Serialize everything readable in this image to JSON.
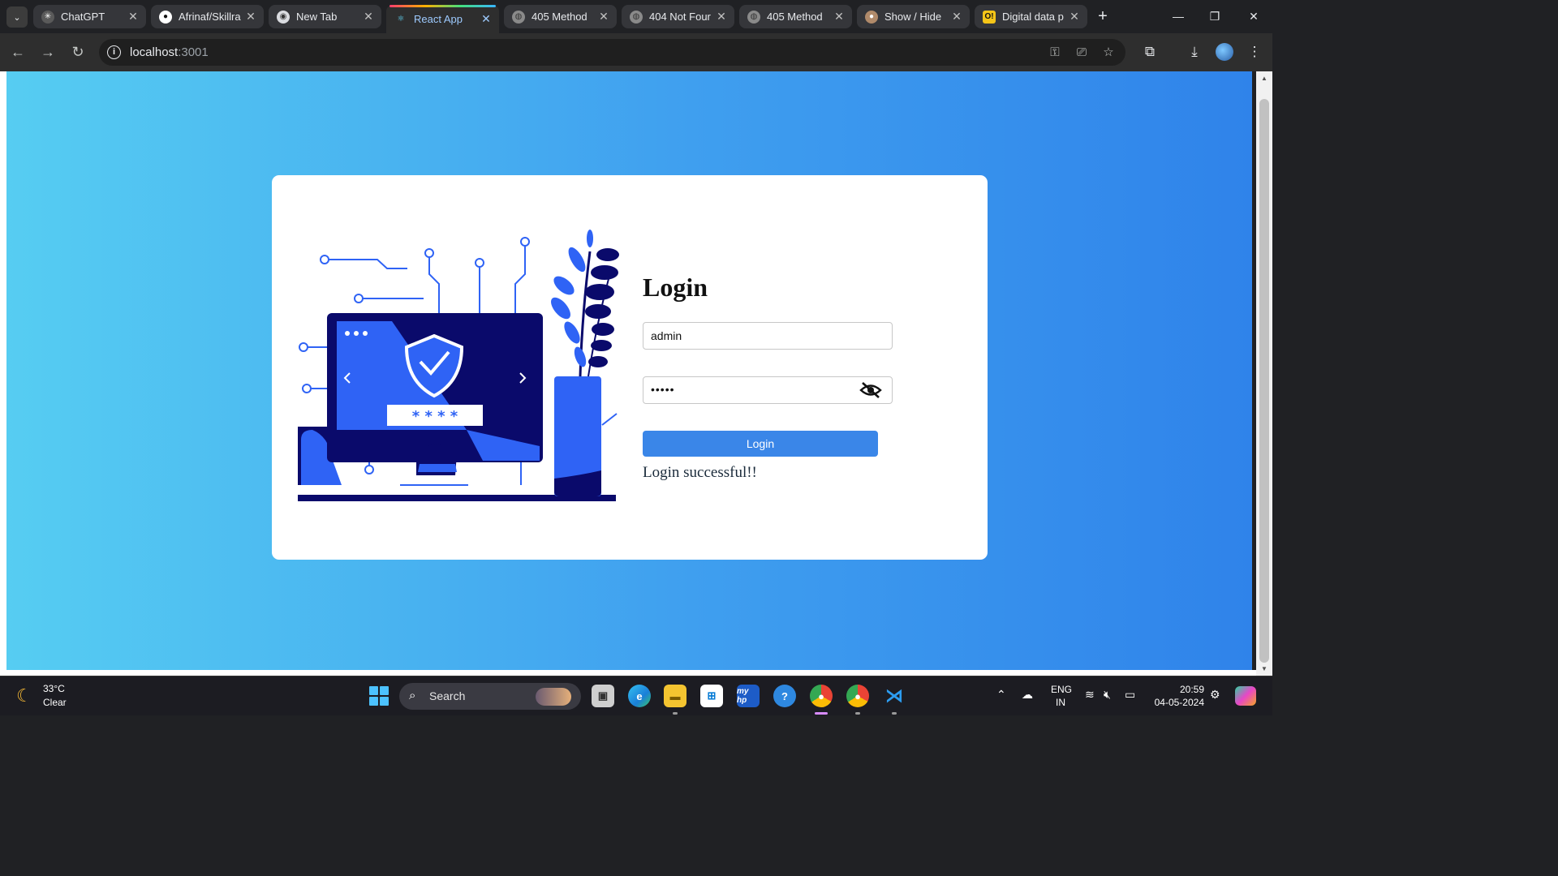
{
  "browser": {
    "tabs": [
      {
        "title": "ChatGPT",
        "icon": "chatgpt-icon"
      },
      {
        "title": "Afrinaf/Skillra",
        "icon": "github-icon"
      },
      {
        "title": "New Tab",
        "icon": "chrome-icon"
      },
      {
        "title": "React App",
        "icon": "react-icon"
      },
      {
        "title": "405 Method",
        "icon": "globe-icon"
      },
      {
        "title": "404 Not Four",
        "icon": "globe-icon"
      },
      {
        "title": "405 Method",
        "icon": "globe-icon"
      },
      {
        "title": "Show / Hide",
        "icon": "avatar-icon"
      },
      {
        "title": "Digital data p",
        "icon": "o-icon"
      }
    ],
    "url_host": "localhost",
    "url_port": ":3001"
  },
  "page": {
    "title": "Login",
    "username_value": "admin",
    "password_value": "•••••",
    "login_button": "Login",
    "status_message": "Login successful!!",
    "illustration_code": "* * * *"
  },
  "taskbar": {
    "temperature": "33°C",
    "condition": "Clear",
    "search_label": "Search",
    "lang_line1": "ENG",
    "lang_line2": "IN",
    "time": "20:59",
    "date": "04-05-2024"
  },
  "colors": {
    "page_gradient_start": "#56cdf2",
    "page_gradient_end": "#2f83ea",
    "login_button": "#3a86e8",
    "illustration_dark": "#0a0a6b",
    "illustration_blue": "#2f63f5"
  }
}
